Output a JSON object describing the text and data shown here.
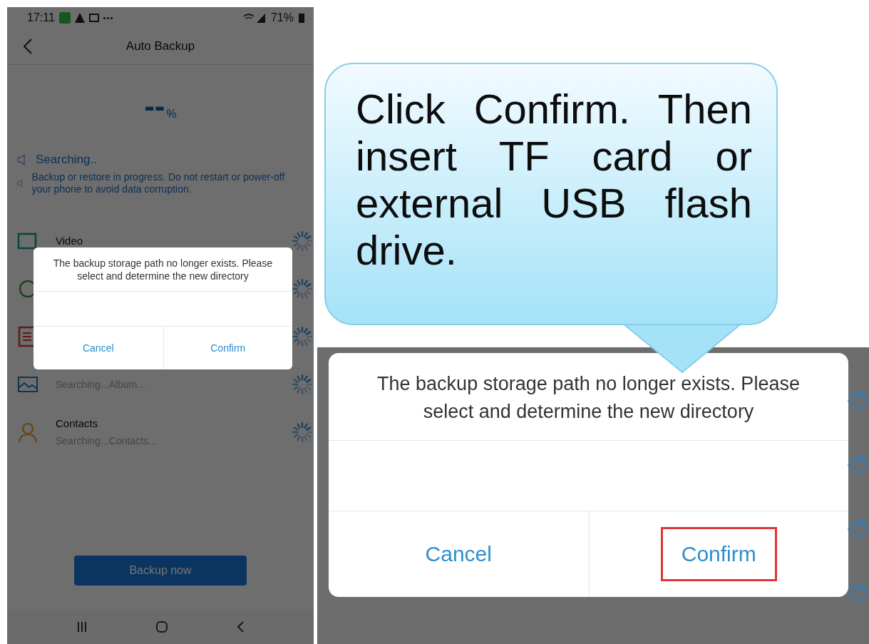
{
  "phone": {
    "status_bar": {
      "time": "17:11",
      "battery": "71%"
    },
    "header": {
      "title": "Auto Backup"
    },
    "progress": {
      "value": "--",
      "unit": "%"
    },
    "notices": [
      "Searching..",
      "Backup or restore in progress. Do not restart or power-off your phone to avoid data corruption."
    ],
    "items": [
      {
        "kind": "video",
        "title": "Video"
      },
      {
        "kind": "circle"
      },
      {
        "kind": "document"
      },
      {
        "kind": "album",
        "subtitle": "Searching...Album..."
      },
      {
        "kind": "contacts",
        "title": "Contacts",
        "subtitle": "Searching...Contacts..."
      }
    ],
    "primary_button": "Backup now",
    "dialog": {
      "message": "The backup storage path no longer exists. Please select and determine the new directory",
      "buttons": [
        {
          "label": "Cancel",
          "highlighted": false
        },
        {
          "label": "Confirm",
          "highlighted": false
        }
      ]
    }
  },
  "callout": {
    "text": "Click Confirm. Then insert TF card or external USB flash drive."
  },
  "zoomed_dialog": {
    "message": "The backup storage path no longer exists. Please select and determine the new directory",
    "buttons": [
      {
        "label": "Cancel",
        "highlighted": false
      },
      {
        "label": "Confirm",
        "highlighted": true
      }
    ]
  }
}
